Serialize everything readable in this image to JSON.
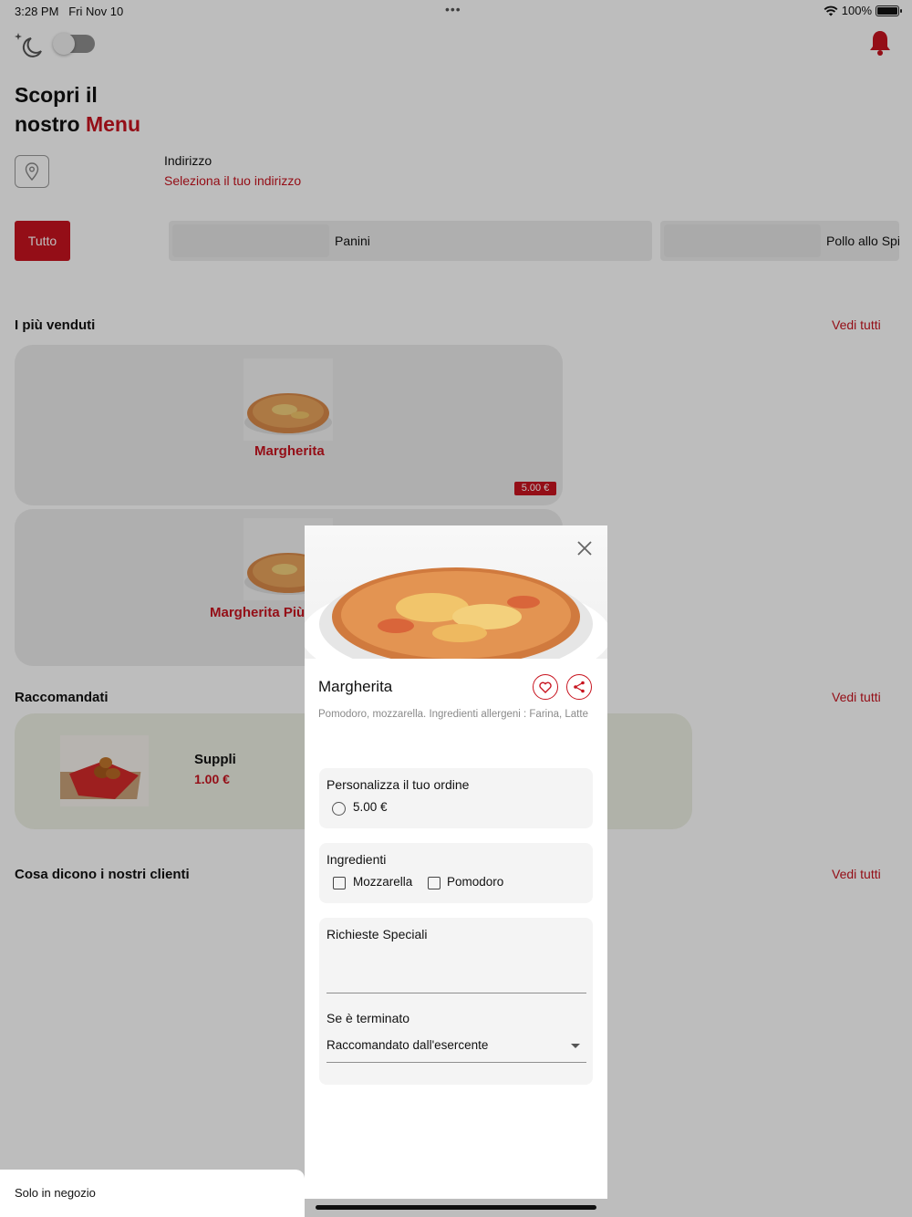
{
  "status": {
    "time": "3:28 PM",
    "date": "Fri Nov 10",
    "battery": "100%"
  },
  "headline": {
    "line1": "Scopri il",
    "line2_prefix": "nostro",
    "line2_accent": "Menu"
  },
  "address": {
    "label": "Indirizzo",
    "link": "Seleziona il tuo indirizzo"
  },
  "categories": [
    {
      "label": "Tutto",
      "active": true
    },
    {
      "label": "Panini",
      "active": false
    },
    {
      "label": "Pollo allo Spi",
      "active": false
    }
  ],
  "bestsellers": {
    "title": "I più venduti",
    "see_all": "Vedi tutti",
    "items": [
      {
        "name": "Margherita",
        "price": "5.00 €"
      },
      {
        "name": "Margherita Più"
      }
    ]
  },
  "recommended": {
    "title": "Raccomandati",
    "see_all": "Vedi tutti",
    "items": [
      {
        "name": "Suppli",
        "price": "1.00 €"
      }
    ]
  },
  "reviews": {
    "title": "Cosa dicono i nostri clienti",
    "see_all": "Vedi tutti"
  },
  "footer": {
    "label": "Solo in negozio"
  },
  "modal": {
    "title": "Margherita",
    "description": "Pomodoro, mozzarella. Ingredienti allergeni : Farina, Latte",
    "customize": {
      "title": "Personalizza il tuo ordine",
      "options": [
        "5.00 €"
      ]
    },
    "ingredients": {
      "title": "Ingredienti",
      "options": [
        "Mozzarella",
        "Pomodoro"
      ]
    },
    "special": {
      "title": "Richieste Speciali",
      "value": ""
    },
    "if_out": {
      "label": "Se è terminato",
      "selected": "Raccomandato dall'esercente"
    }
  },
  "colors": {
    "accent": "#c8141f",
    "card": "#ececec",
    "recommended_card": "#eef1e4"
  },
  "icons": [
    "moon-icon",
    "bell-icon",
    "location-pin-icon",
    "close-icon",
    "heart-icon",
    "share-icon",
    "chevron-down-icon",
    "wifi-icon",
    "battery-icon"
  ]
}
